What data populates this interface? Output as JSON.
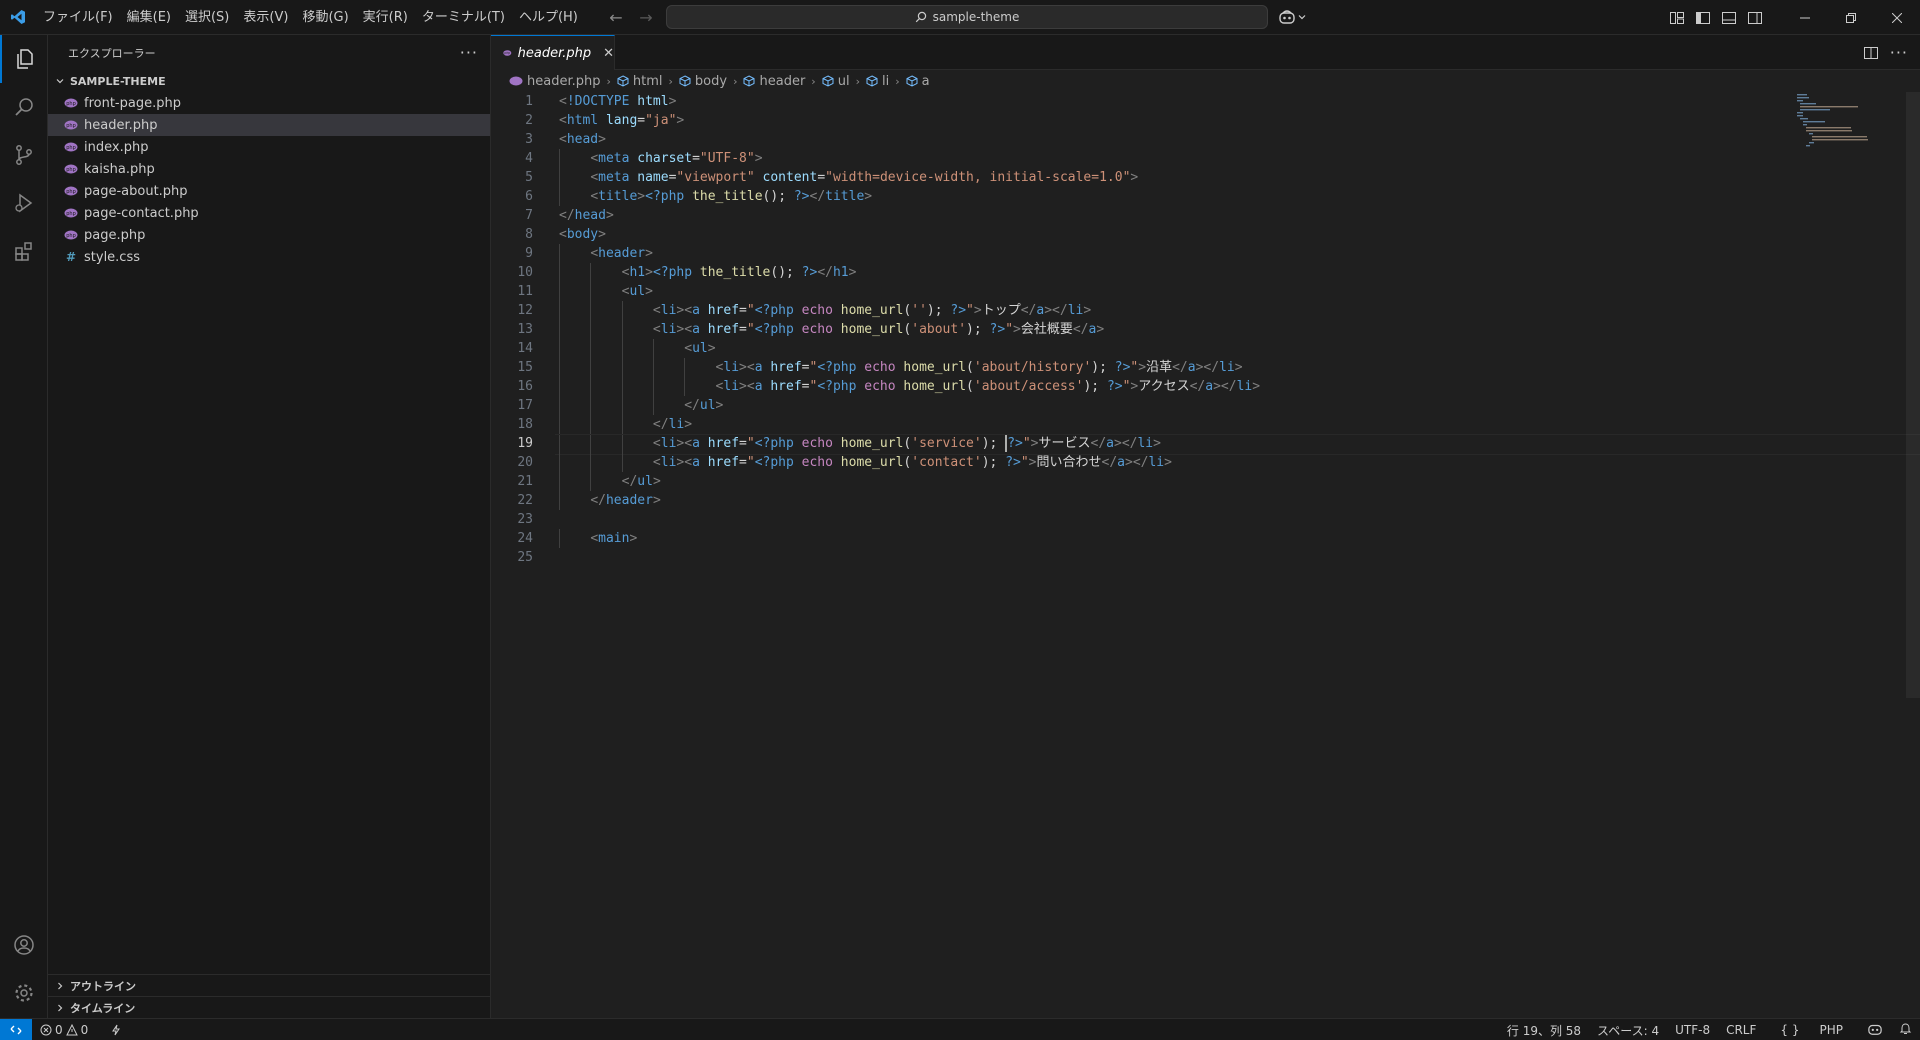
{
  "titlebar": {
    "menu": [
      "ファイル(F)",
      "編集(E)",
      "選択(S)",
      "表示(V)",
      "移動(G)",
      "実行(R)",
      "ターミナル(T)",
      "ヘルプ(H)"
    ],
    "search_text": "sample-theme"
  },
  "sidebar": {
    "title": "エクスプローラー",
    "folder": "SAMPLE-THEME",
    "files": [
      {
        "name": "front-page.php",
        "type": "php"
      },
      {
        "name": "header.php",
        "type": "php",
        "selected": true
      },
      {
        "name": "index.php",
        "type": "php"
      },
      {
        "name": "kaisha.php",
        "type": "php"
      },
      {
        "name": "page-about.php",
        "type": "php"
      },
      {
        "name": "page-contact.php",
        "type": "php"
      },
      {
        "name": "page.php",
        "type": "php"
      },
      {
        "name": "style.css",
        "type": "css"
      }
    ],
    "outline": "アウトライン",
    "timeline": "タイムライン"
  },
  "editor": {
    "tab": {
      "label": "header.php"
    },
    "breadcrumb": [
      "header.php",
      "html",
      "body",
      "header",
      "ul",
      "li",
      "a"
    ],
    "active_line": 19
  },
  "code_lines": [
    "<!DOCTYPE html>",
    "<html lang=\"ja\">",
    "<head>",
    "    <meta charset=\"UTF-8\">",
    "    <meta name=\"viewport\" content=\"width=device-width, initial-scale=1.0\">",
    "    <title><?php the_title(); ?></title>",
    "</head>",
    "<body>",
    "    <header>",
    "        <h1><?php the_title(); ?></h1>",
    "        <ul>",
    "            <li><a href=\"<?php echo home_url(''); ?>\">トップ</a></li>",
    "            <li><a href=\"<?php echo home_url('about'); ?>\">会社概要</a>",
    "                <ul>",
    "                    <li><a href=\"<?php echo home_url('about/history'); ?>\">沿革</a></li>",
    "                    <li><a href=\"<?php echo home_url('about/access'); ?>\">アクセス</a></li>",
    "                </ul>",
    "            </li>",
    "            <li><a href=\"<?php echo home_url('service'); ?>\">サービス</a></li>",
    "            <li><a href=\"<?php echo home_url('contact'); ?>\">問い合わせ</a></li>",
    "        </ul>",
    "    </header>",
    "",
    "    <main>",
    ""
  ],
  "statusbar": {
    "errors": "0",
    "warnings": "0",
    "position": "行 19、列 58",
    "spaces": "スペース: 4",
    "encoding": "UTF-8",
    "eol": "CRLF",
    "language": "PHP"
  },
  "colors": {
    "accent": "#0078d4",
    "php_icon": "#a074c4"
  }
}
